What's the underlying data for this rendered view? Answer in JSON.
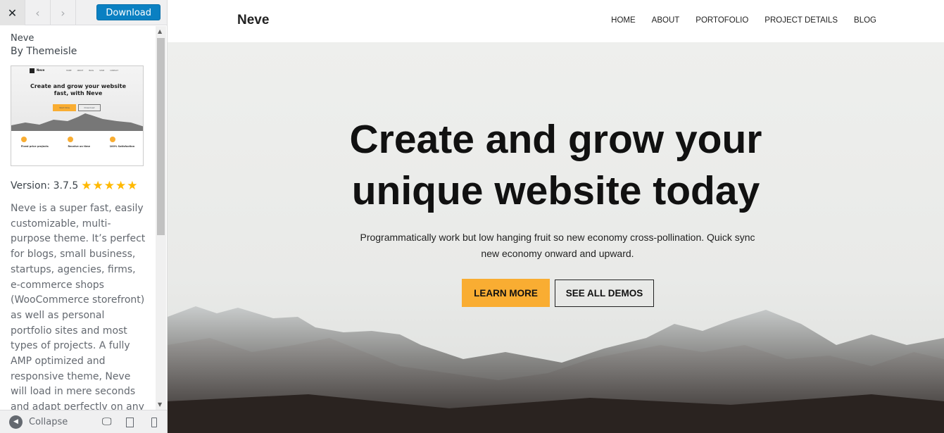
{
  "sidebar": {
    "download_label": "Download",
    "theme_name": "Neve",
    "author": "By Themeisle",
    "version": "Version: 3.7.5",
    "rating": 5,
    "rating_max": 5,
    "description": "Neve is a super fast, easily customizable, multi-purpose theme. It’s perfect for blogs, small business, startups, agencies, firms, e-commerce shops (WooCommerce storefront) as well as personal portfolio sites and most types of projects. A fully AMP optimized and responsive theme, Neve will load in mere seconds and adapt perfectly on any viewing",
    "collapse_label": "Collapse",
    "thumbnail": {
      "brand": "Neve",
      "nav": [
        "HOME",
        "ABOUT",
        "BLOG",
        "SHOP",
        "CONTACT"
      ],
      "headline": "Create and grow your website fast, with Neve",
      "btn1": "Start Now",
      "btn2": "Download",
      "features": [
        "Fixed price projects",
        "Receive on time",
        "100% Satisfaction"
      ]
    },
    "accent": "#0a80c2",
    "star_color": "#ffb900"
  },
  "preview": {
    "logo": "Neve",
    "nav": [
      "HOME",
      "ABOUT",
      "PORTOFOLIO",
      "PROJECT DETAILS",
      "BLOG"
    ],
    "headline_line1": "Create and grow your",
    "headline_line2": "unique website today",
    "subtitle": "Programmatically work but low hanging fruit so new economy cross-pollination. Quick sync new economy onward and upward.",
    "primary_button": "LEARN MORE",
    "secondary_button": "SEE ALL DEMOS",
    "primary_color": "#f9ad32"
  }
}
